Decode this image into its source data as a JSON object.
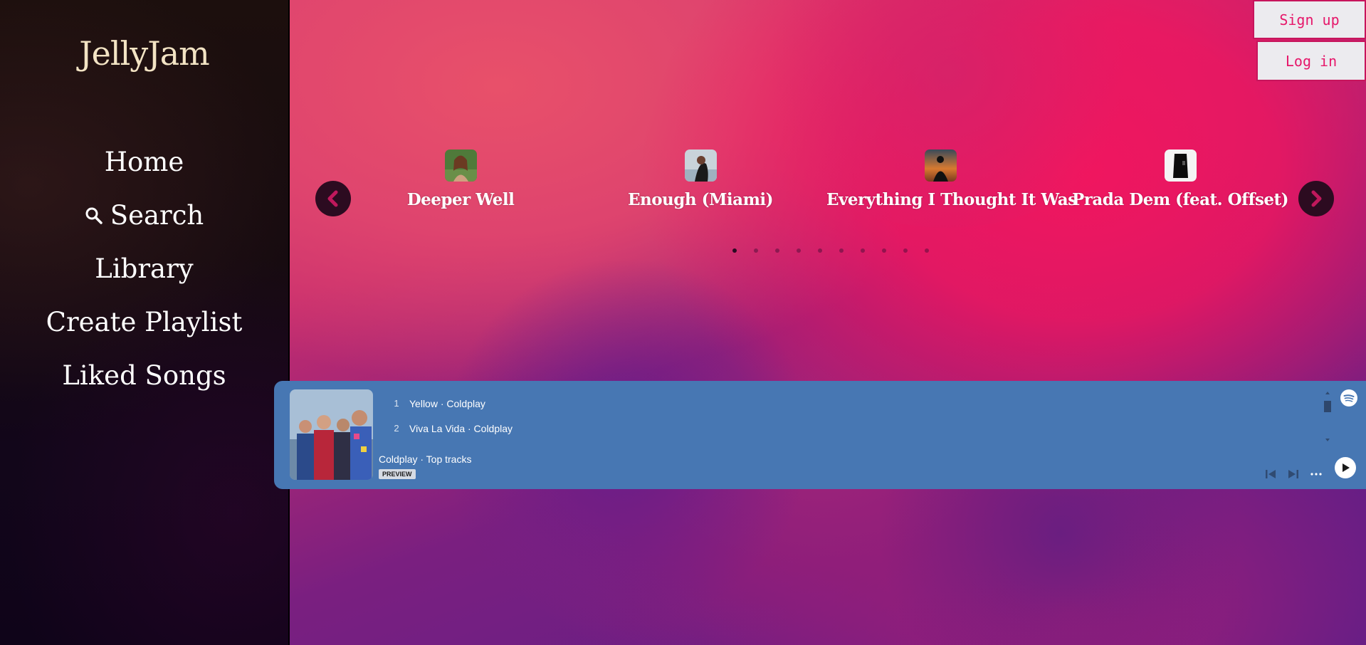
{
  "app": {
    "logo": "JellyJam"
  },
  "sidebar": {
    "items": [
      {
        "label": "Home",
        "icon": ""
      },
      {
        "label": "Search",
        "icon": "search-icon"
      },
      {
        "label": "Library",
        "icon": ""
      },
      {
        "label": "Create Playlist",
        "icon": ""
      },
      {
        "label": "Liked Songs",
        "icon": ""
      }
    ]
  },
  "auth": {
    "signup_label": "Sign up",
    "login_label": "Log in"
  },
  "carousel": {
    "slides": [
      {
        "title": "Deeper Well",
        "thumb_color": "#5a7a3a"
      },
      {
        "title": "Enough (Miami)",
        "thumb_color": "#b9c4cc"
      },
      {
        "title": "Everything I Thought It Was",
        "thumb_color": "#b0602a"
      },
      {
        "title": "Prada Dem (feat. Offset)",
        "thumb_color": "#e8e8e8"
      }
    ],
    "dot_count": 10,
    "active_dot": 0
  },
  "embed": {
    "tracks": [
      {
        "num": "1",
        "label": "Yellow · Coldplay"
      },
      {
        "num": "2",
        "label": "Viva La Vida · Coldplay"
      }
    ],
    "title": "Coldplay · Top tracks",
    "badge": "PREVIEW"
  },
  "colors": {
    "accent": "#e6176a",
    "sidebar_bg": "#140812",
    "embed_bg": "#4777b3",
    "logo": "#f3e4c4"
  }
}
